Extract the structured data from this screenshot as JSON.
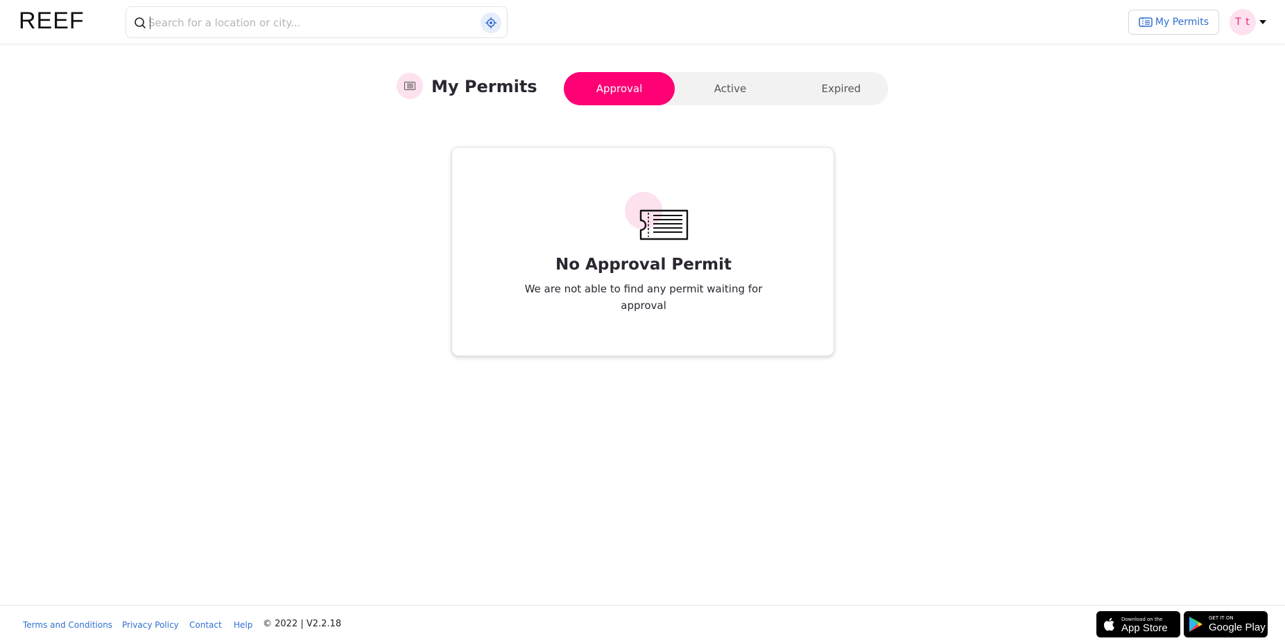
{
  "header": {
    "logo": "REEF",
    "search_placeholder": "Search for a location or city...",
    "my_permits_label": "My Permits",
    "avatar_initials": "T t"
  },
  "page": {
    "title": "My Permits",
    "tabs": [
      {
        "label": "Approval",
        "active": true
      },
      {
        "label": "Active",
        "active": false
      },
      {
        "label": "Expired",
        "active": false
      }
    ]
  },
  "empty_state": {
    "title": "No Approval Permit",
    "description": "We are not able to find any permit waiting for approval"
  },
  "footer": {
    "links": [
      "Terms and Conditions",
      "Privacy Policy",
      "Contact",
      "Help"
    ],
    "copyright": "© 2022 | V2.2.18",
    "app_store": {
      "small": "Download on the",
      "big": "App Store"
    },
    "google_play": {
      "small": "GET IT ON",
      "big": "Google Play"
    }
  },
  "colors": {
    "accent": "#fe0074",
    "accent_light": "#fde1ef",
    "link": "#2f6fd1"
  },
  "icons": [
    "search-icon",
    "locate-icon",
    "permit-icon",
    "ticket-icon",
    "chevron-down-icon",
    "apple-icon",
    "google-play-icon"
  ]
}
